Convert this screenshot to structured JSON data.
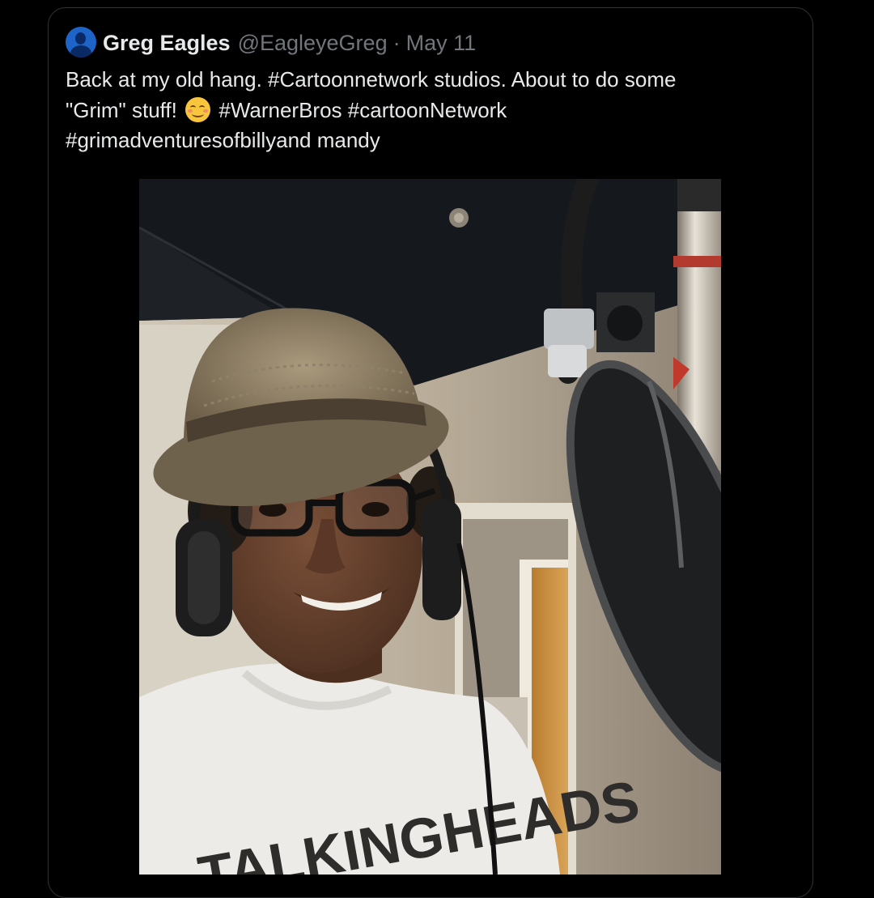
{
  "tweet": {
    "display_name": "Greg Eagles",
    "handle": "@EagleyeGreg",
    "separator": "·",
    "date": "May 11",
    "text_lines": [
      "Back at my old hang. #Cartoonnetwork studios. About to do some",
      "\"Grim\" stuff!",
      "#WarnerBros #cartoonNetwork",
      "#grimadventuresofbillyand mandy"
    ],
    "emoji": "smiling-face-with-smiling-eyes"
  },
  "media": {
    "shirt_text": "TALKINGHEADS"
  },
  "colors": {
    "background": "#000000",
    "text_primary": "#e7e9ea",
    "text_secondary": "#71767b",
    "border": "#2f3336",
    "avatar_blue": "#1d63c8"
  }
}
